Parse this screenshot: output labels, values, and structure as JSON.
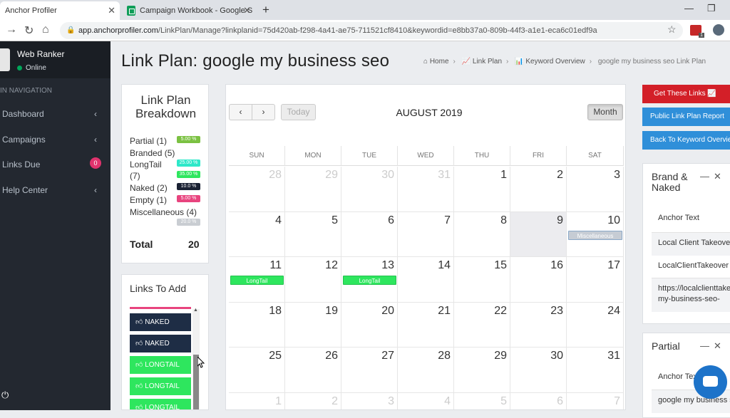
{
  "browser": {
    "tabs": [
      {
        "title": "Anchor Profiler",
        "active": true
      },
      {
        "title": "Campaign Workbook - Google S",
        "active": false
      }
    ],
    "url_host": "app.anchorprofiler.com",
    "url_path": "/LinkPlan/Manage?linkplanid=75d420ab-f298-4a41-ae75-711521cf8410&keywordid=e8bb37a0-809b-44f3-a1e1-eca6c01edf9a"
  },
  "sidebar": {
    "user_name": "Web Ranker",
    "status": "Online",
    "nav_header": "IN NAVIGATION",
    "items": [
      {
        "label": "Dashboard"
      },
      {
        "label": "Campaigns"
      },
      {
        "label": "Links Due",
        "badge": "0"
      },
      {
        "label": "Help Center"
      }
    ]
  },
  "page": {
    "title": "Link Plan: google my business seo",
    "breadcrumb": [
      "Home",
      "Link Plan",
      "Keyword Overview",
      "google my business seo Link Plan"
    ]
  },
  "breakdown": {
    "title": "Link Plan Breakdown",
    "rows": [
      {
        "label": "Partial (1)",
        "badge": "5.00 %",
        "color": "#7bc142"
      },
      {
        "label": "Branded (5)",
        "badge": "",
        "color": ""
      },
      {
        "label": "LongTail",
        "badge": "25.00 %",
        "color": "#2ee8c9"
      },
      {
        "label": "(7)",
        "badge": "35.00 %",
        "color": "#2ee65e"
      },
      {
        "label": "Naked (2)",
        "badge": "10.0 %",
        "color": "#1a2133"
      },
      {
        "label": "Empty (1)",
        "badge": "5.00 %",
        "color": "#e8447e"
      },
      {
        "label": "Miscellaneous (4)",
        "badge": "",
        "color": ""
      },
      {
        "label": "",
        "badge": "20.0 %",
        "color": "#c9cdd2"
      }
    ],
    "total_label": "Total",
    "total_value": "20"
  },
  "links_to_add": {
    "title": "Links To Add",
    "items": [
      {
        "label": "NAKED",
        "type": "naked"
      },
      {
        "label": "NAKED",
        "type": "naked"
      },
      {
        "label": "LONGTAIL",
        "type": "longtail"
      },
      {
        "label": "LONGTAIL",
        "type": "longtail"
      },
      {
        "label": "LONGTAIL",
        "type": "longtail"
      }
    ]
  },
  "calendar": {
    "prev": "‹",
    "next": "›",
    "today": "Today",
    "title": "AUGUST 2019",
    "view": "Month",
    "weekdays": [
      "SUN",
      "MON",
      "TUE",
      "WED",
      "THU",
      "FRI",
      "SAT"
    ],
    "weeks": [
      [
        "28",
        "29",
        "30",
        "31",
        "1",
        "2",
        "3"
      ],
      [
        "4",
        "5",
        "6",
        "7",
        "8",
        "9",
        "10"
      ],
      [
        "11",
        "12",
        "13",
        "14",
        "15",
        "16",
        "17"
      ],
      [
        "18",
        "19",
        "20",
        "21",
        "22",
        "23",
        "24"
      ],
      [
        "25",
        "26",
        "27",
        "28",
        "29",
        "30",
        "31"
      ],
      [
        "1",
        "2",
        "3",
        "4",
        "5",
        "6",
        "7"
      ]
    ],
    "today_day": "9",
    "events": [
      {
        "week": 1,
        "day": 6,
        "label": "Miscellaneous",
        "type": "misc"
      },
      {
        "week": 2,
        "day": 0,
        "label": "LongTail",
        "type": "longtail"
      },
      {
        "week": 2,
        "day": 2,
        "label": "LongTail",
        "type": "longtail"
      }
    ]
  },
  "actions": {
    "get_links": "Get These Links",
    "public_report": "Public Link Plan Report",
    "back": "Back To Keyword Overview"
  },
  "brand_naked": {
    "title_line1": "Brand &",
    "title_line2": "Naked",
    "anchor_label": "Anchor Text",
    "anchor_value": "Local Client Takeover",
    "row2": "LocalClientTakeover",
    "url_line1": "https://localclienttakeover.com/google-",
    "url_line2": "my-business-seo-"
  },
  "partial": {
    "title": "Partial",
    "anchor_label": "Anchor Text",
    "anchor_value": "google my business seo"
  }
}
